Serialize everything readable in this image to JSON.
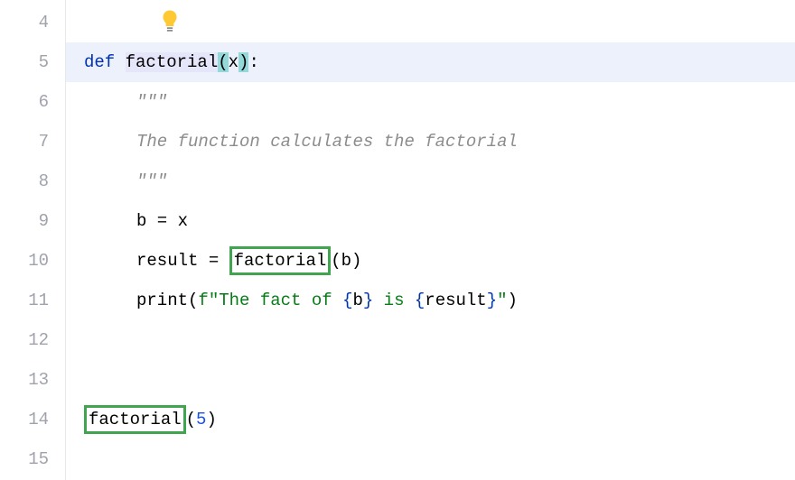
{
  "gutter": {
    "start": 4,
    "end": 15
  },
  "highlighted_line": 5,
  "icons": {
    "bulb": "lightbulb-icon"
  },
  "code": {
    "line5": {
      "kw": "def ",
      "fname": "factorial",
      "lparen": "(",
      "param": "x",
      "rparen": ")",
      "colon": ":"
    },
    "line6": {
      "docq": "\"\"\""
    },
    "line7": {
      "doc": "The function calculates the factorial"
    },
    "line8": {
      "docq": "\"\"\""
    },
    "line9": {
      "text": "b = x"
    },
    "line10": {
      "pre": "result = ",
      "boxed": "factorial",
      "post": "(b)"
    },
    "line11": {
      "call": "print",
      "lp": "(",
      "fpre": "f",
      "q1": "\"",
      "s1": "The fact of ",
      "lb1": "{",
      "v1": "b",
      "rb1": "}",
      "s2": " is ",
      "lb2": "{",
      "v2": "result",
      "rb2": "}",
      "q2": "\"",
      "rp": ")"
    },
    "line14": {
      "boxed": "factorial",
      "lp": "(",
      "num": "5",
      "rp": ")"
    }
  }
}
